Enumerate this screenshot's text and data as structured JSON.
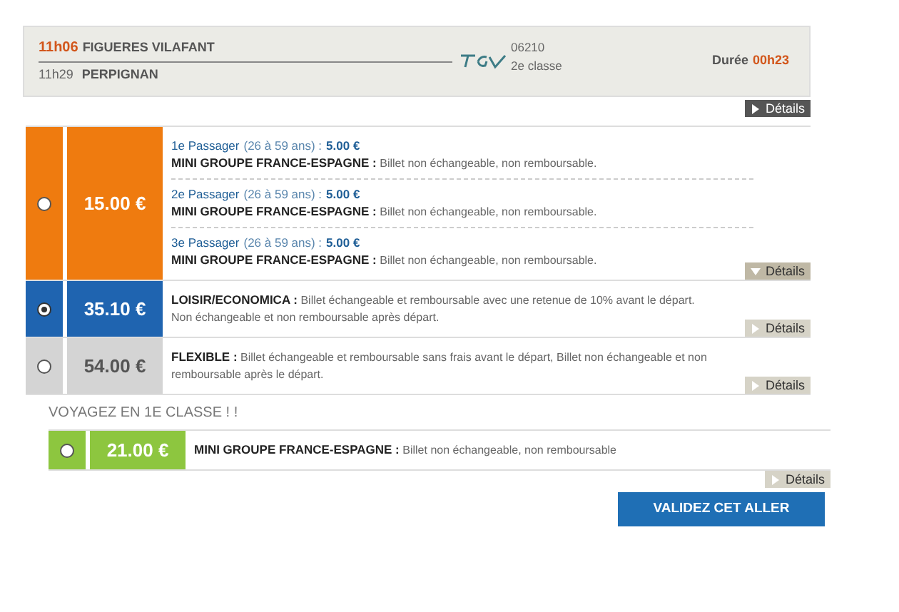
{
  "journey": {
    "departure_time": "11h06",
    "departure_station": "FIGUERES VILAFANT",
    "arrival_time": "11h29",
    "arrival_station": "PERPIGNAN",
    "train_number": "06210",
    "class": "2e classe",
    "duration_label": "Durée",
    "duration": "00h23",
    "details": "Détails"
  },
  "fares": [
    {
      "price": "15.00 €",
      "color": "#ef7b0f",
      "selected": false,
      "details": "Détails",
      "details_expanded": true,
      "items": [
        {
          "passenger": "1e Passager",
          "age": "(26 à 59 ans) :",
          "passenger_price": "5.00 €",
          "product": "MINI GROUPE FRANCE-ESPAGNE :",
          "conditions": "Billet non échangeable, non remboursable."
        },
        {
          "passenger": "2e Passager",
          "age": "(26 à 59 ans) :",
          "passenger_price": "5.00 €",
          "product": "MINI GROUPE FRANCE-ESPAGNE :",
          "conditions": "Billet non échangeable, non remboursable."
        },
        {
          "passenger": "3e Passager",
          "age": "(26 à 59 ans) :",
          "passenger_price": "5.00 €",
          "product": "MINI GROUPE FRANCE-ESPAGNE :",
          "conditions": "Billet non échangeable, non remboursable."
        }
      ]
    },
    {
      "price": "35.10 €",
      "color": "#1f64b0",
      "selected": true,
      "details": "Détails",
      "details_expanded": false,
      "items": [
        {
          "product": "LOISIR/ECONOMICA :",
          "conditions": "Billet échangeable et remboursable avec une retenue de 10% avant le départ. Non échangeable et non remboursable après départ."
        }
      ]
    },
    {
      "price": "54.00 €",
      "color": "#d4d4d4",
      "selected": false,
      "details": "Détails",
      "details_expanded": false,
      "items": [
        {
          "product": "FLEXIBLE :",
          "conditions": "Billet échangeable et remboursable sans frais avant le départ, Billet non échangeable et non remboursable après le départ."
        }
      ]
    }
  ],
  "first_class": {
    "title": "VOYAGEZ EN 1E CLASSE ! !",
    "fares": [
      {
        "price": "21.00 €",
        "color": "#8dc63f",
        "selected": false,
        "details": "Détails",
        "details_expanded": false,
        "items": [
          {
            "product": "MINI GROUPE FRANCE-ESPAGNE :",
            "conditions": "Billet non échangeable, non remboursable"
          }
        ]
      }
    ]
  },
  "validate_button": "VALIDEZ CET ALLER"
}
